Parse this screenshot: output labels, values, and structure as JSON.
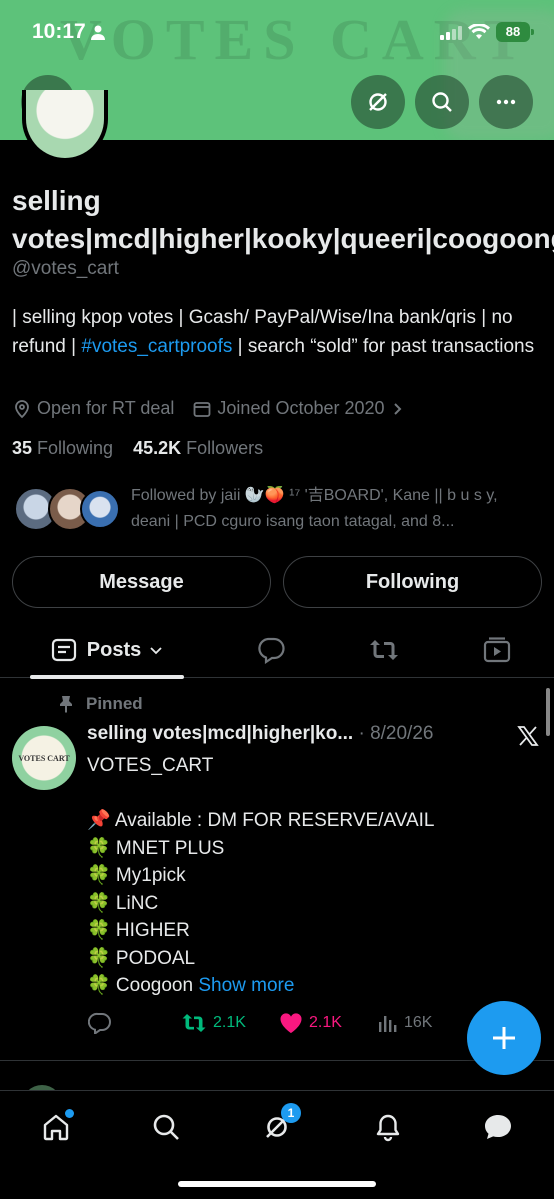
{
  "status_bar": {
    "time": "10:17",
    "battery": "88"
  },
  "banner": {
    "text": "VOTES CART"
  },
  "profile": {
    "name": "selling votes|mcd|higher|kooky|queeri|coogoong",
    "handle": "@votes_cart",
    "bio_before": "| selling kpop votes | Gcash/ PayPal/Wise/Ina bank/qris | no refund | ",
    "bio_link": "#votes_cartproofs",
    "bio_after": " | search “sold” for past transactions",
    "location": "Open for RT deal",
    "joined": "Joined October 2020",
    "following_count": "35",
    "following_label": " Following",
    "followers_count": "45.2K",
    "followers_label": " Followers",
    "followed_by": "Followed by jaii 🦭🍑 ¹⁷ '吉BOARD', Kane || b u s y, deani | PCD cguro isang taon tatagal, and 8..."
  },
  "buttons": {
    "message": "Message",
    "following": "Following"
  },
  "tabs": {
    "posts": "Posts"
  },
  "pinned_label": "Pinned",
  "post": {
    "avatar_text": "VOTES CART",
    "name": "selling votes|mcd|higher|ko...",
    "separator": " · ",
    "date": "8/20/26",
    "lines": [
      "VOTES_CART",
      "",
      "📌 Available : DM FOR RESERVE/AVAIL",
      "🍀 MNET PLUS",
      "🍀 My1pick",
      "🍀 LiNC",
      "🍀 HIGHER",
      "🍀 PODOAL",
      "🍀 Coogoon "
    ],
    "show_more": "Show more",
    "retweets": "2.1K",
    "likes": "2.1K",
    "views": "16K"
  },
  "nav": {
    "grok_badge": "1"
  },
  "colors": {
    "accent": "#1d9bf0",
    "banner": "#5dc27a",
    "retweet": "#00ba7c",
    "like": "#f91880"
  }
}
